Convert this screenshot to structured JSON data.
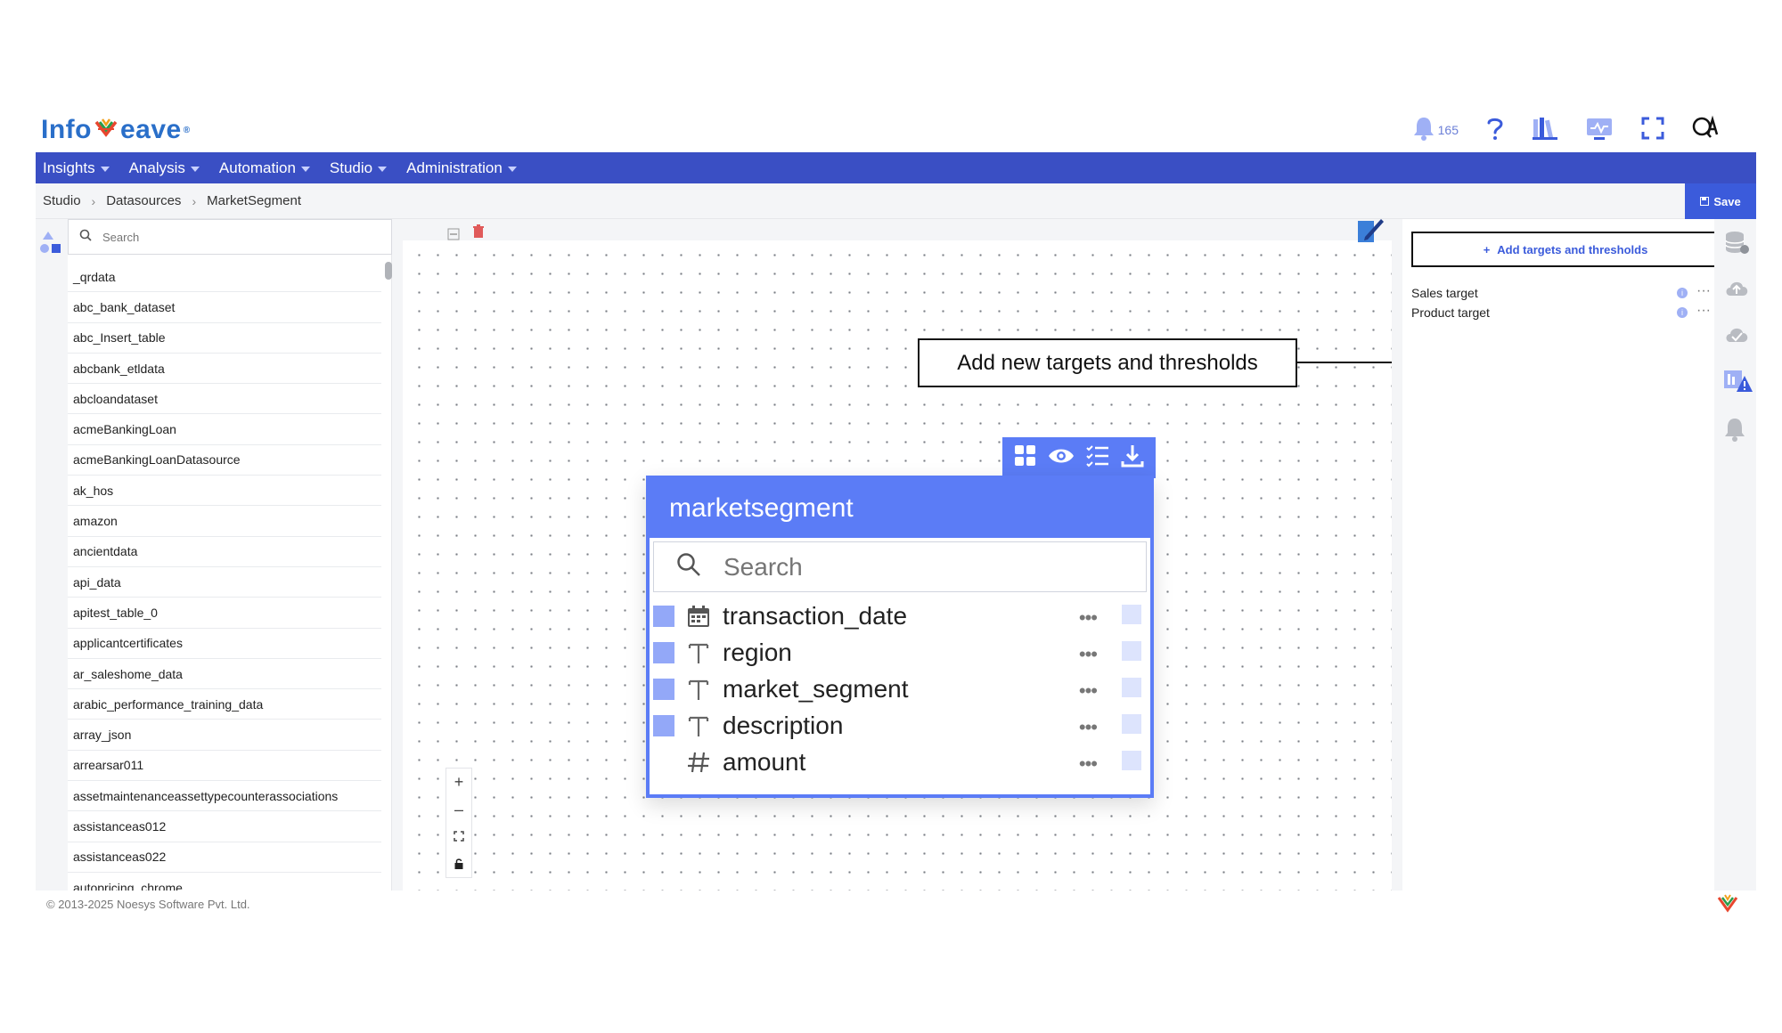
{
  "app": {
    "brand_left": "Info",
    "brand_right": "eave",
    "brand_tm": "®"
  },
  "header": {
    "notification_count": "165"
  },
  "nav": {
    "items": [
      {
        "label": "Insights"
      },
      {
        "label": "Analysis"
      },
      {
        "label": "Automation"
      },
      {
        "label": "Studio"
      },
      {
        "label": "Administration"
      }
    ]
  },
  "breadcrumb": {
    "items": [
      "Studio",
      "Datasources",
      "MarketSegment"
    ]
  },
  "toolbar": {
    "save_label": "Save"
  },
  "list": {
    "search_placeholder": "Search",
    "items": [
      "_qrdata",
      "abc_bank_dataset",
      "abc_Insert_table",
      "abcbank_etldata",
      "abcloandataset",
      "acmeBankingLoan",
      "acmeBankingLoanDatasource",
      "ak_hos",
      "amazon",
      "ancientdata",
      "api_data",
      "apitest_table_0",
      "applicantcertificates",
      "ar_saleshome_data",
      "arabic_performance_training_data",
      "array_json",
      "arrearsar011",
      "assetmaintenanceassettypecounterassociations",
      "assistanceas012",
      "assistanceas022",
      "autopricing_chrome"
    ]
  },
  "card": {
    "title": "marketsegment",
    "search_placeholder": "Search",
    "fields": [
      {
        "name": "transaction_date",
        "type": "date",
        "checked": true
      },
      {
        "name": "region",
        "type": "text",
        "checked": true
      },
      {
        "name": "market_segment",
        "type": "text",
        "checked": true
      },
      {
        "name": "description",
        "type": "text",
        "checked": true
      },
      {
        "name": "amount",
        "type": "number",
        "checked": false
      }
    ]
  },
  "callout": {
    "text": "Add new targets and thresholds"
  },
  "rightpanel": {
    "add_button": "Add targets and thresholds",
    "targets": [
      {
        "label": "Sales target"
      },
      {
        "label": "Product target"
      }
    ]
  },
  "footer": {
    "copyright": "© 2013-2025 Noesys Software Pvt. Ltd."
  },
  "colors": {
    "primary": "#3a4fc4",
    "accent": "#5b7cf6",
    "checkbox": "#93a8f8"
  }
}
